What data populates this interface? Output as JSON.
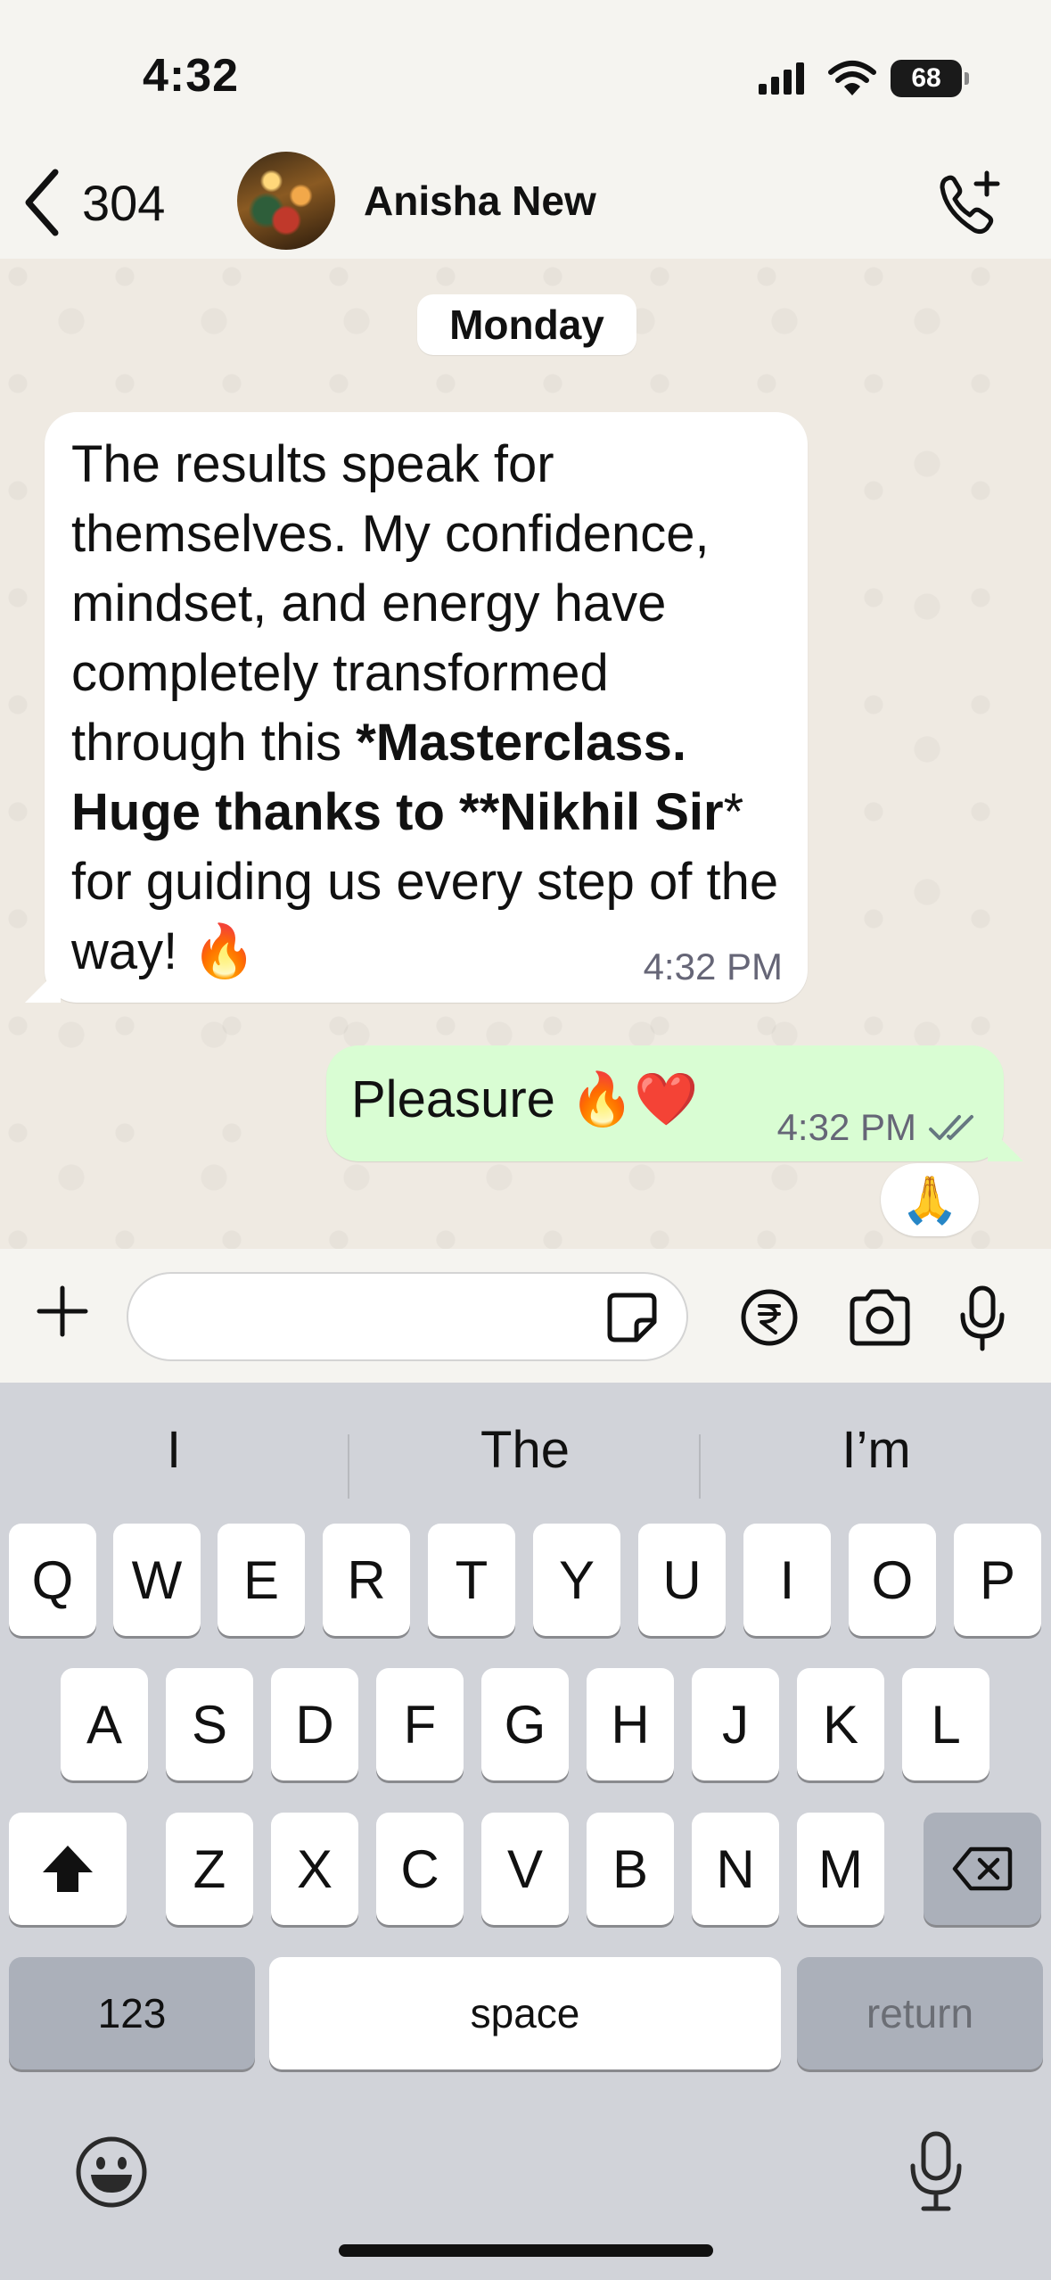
{
  "status_bar": {
    "time": "4:32",
    "battery": "68"
  },
  "header": {
    "back_count": "304",
    "contact_name": "Anisha New"
  },
  "chat": {
    "date_label": "Monday",
    "incoming": {
      "text_1": "The results speak for themselves. My confidence, mindset, and energy have completely transformed through this ",
      "text_bold": "*Masterclass. Huge thanks to **Nikhil Sir",
      "text_2": "* for guiding us every step of the way! 🔥",
      "time": "4:32 PM"
    },
    "outgoing": {
      "text": "Pleasure 🔥❤️",
      "time": "4:32 PM",
      "status": "read",
      "reaction": "🙏"
    }
  },
  "input_bar": {
    "placeholder": ""
  },
  "keyboard": {
    "suggestions": [
      "I",
      "The",
      "I’m"
    ],
    "row1": [
      "Q",
      "W",
      "E",
      "R",
      "T",
      "Y",
      "U",
      "I",
      "O",
      "P"
    ],
    "row2": [
      "A",
      "S",
      "D",
      "F",
      "G",
      "H",
      "J",
      "K",
      "L"
    ],
    "row3": [
      "Z",
      "X",
      "C",
      "V",
      "B",
      "N",
      "M"
    ],
    "numbers_key": "123",
    "space_key": "space",
    "return_key": "return"
  },
  "colors": {
    "chat_bg": "#efeae2",
    "incoming_bubble": "#ffffff",
    "outgoing_bubble": "#d9fdd3",
    "keyboard_bg": "#d1d3d9",
    "read_ticks": "#667781"
  }
}
